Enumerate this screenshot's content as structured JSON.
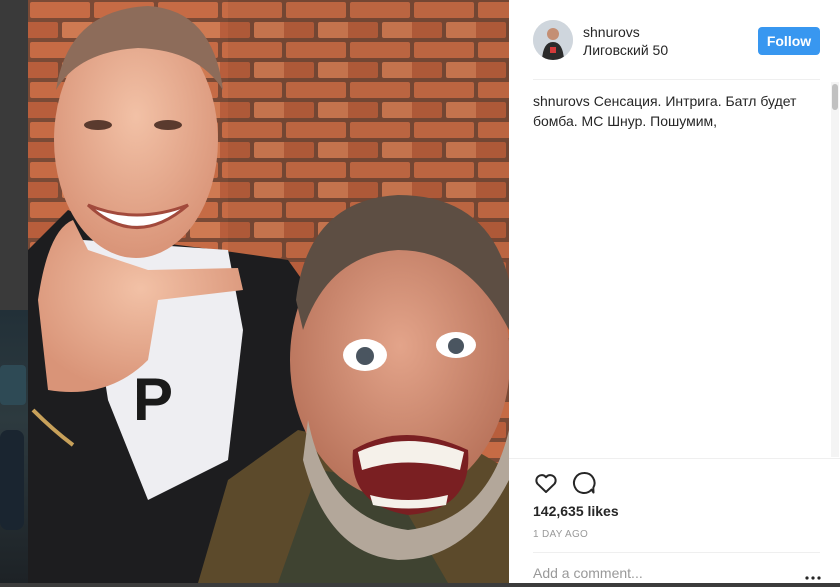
{
  "post": {
    "username": "shnurovs",
    "location": "Лиговский 50",
    "follow_label": "Follow",
    "caption_user": "shnurovs",
    "caption_text": "Сенсация. Интрига. Батл будет бомба. МС Шнур. Пошумим,",
    "likes": "142,635 likes",
    "time": "1 DAY AGO",
    "comment_placeholder": "Add a comment..."
  },
  "icons": {
    "like": "heart-icon",
    "comment": "comment-bubble-icon",
    "more": "more-options-icon"
  },
  "colors": {
    "accent": "#3897f0",
    "text": "#262626",
    "muted": "#999999",
    "divider": "#efefef"
  }
}
